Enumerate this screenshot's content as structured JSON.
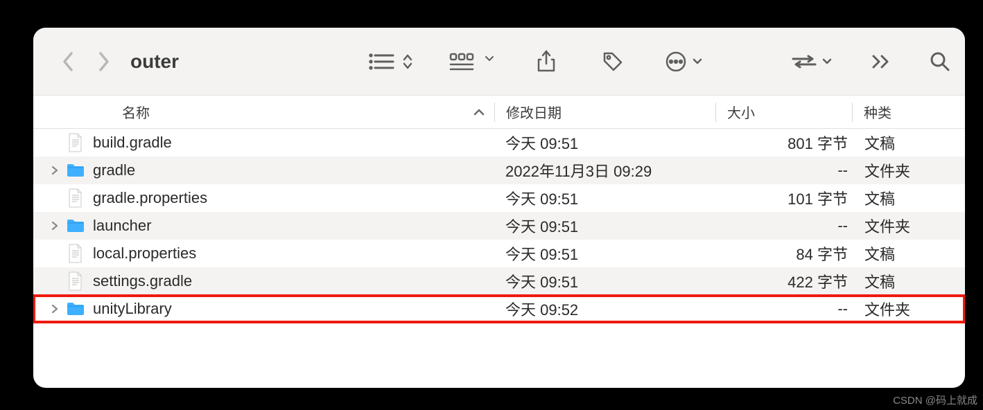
{
  "window": {
    "title": "outer"
  },
  "columns": {
    "name": "名称",
    "date": "修改日期",
    "size": "大小",
    "kind": "种类"
  },
  "rows": [
    {
      "name": "build.gradle",
      "date": "今天 09:51",
      "size": "801 字节",
      "kind": "文稿",
      "type": "file",
      "highlight": false
    },
    {
      "name": "gradle",
      "date": "2022年11月3日 09:29",
      "size": "--",
      "kind": "文件夹",
      "type": "folder",
      "highlight": false
    },
    {
      "name": "gradle.properties",
      "date": "今天 09:51",
      "size": "101 字节",
      "kind": "文稿",
      "type": "file",
      "highlight": false
    },
    {
      "name": "launcher",
      "date": "今天 09:51",
      "size": "--",
      "kind": "文件夹",
      "type": "folder",
      "highlight": false
    },
    {
      "name": "local.properties",
      "date": "今天 09:51",
      "size": "84 字节",
      "kind": "文稿",
      "type": "file",
      "highlight": false
    },
    {
      "name": "settings.gradle",
      "date": "今天 09:51",
      "size": "422 字节",
      "kind": "文稿",
      "type": "file",
      "highlight": false
    },
    {
      "name": "unityLibrary",
      "date": "今天 09:52",
      "size": "--",
      "kind": "文件夹",
      "type": "folder",
      "highlight": true
    }
  ],
  "watermark": "CSDN @码上就成"
}
